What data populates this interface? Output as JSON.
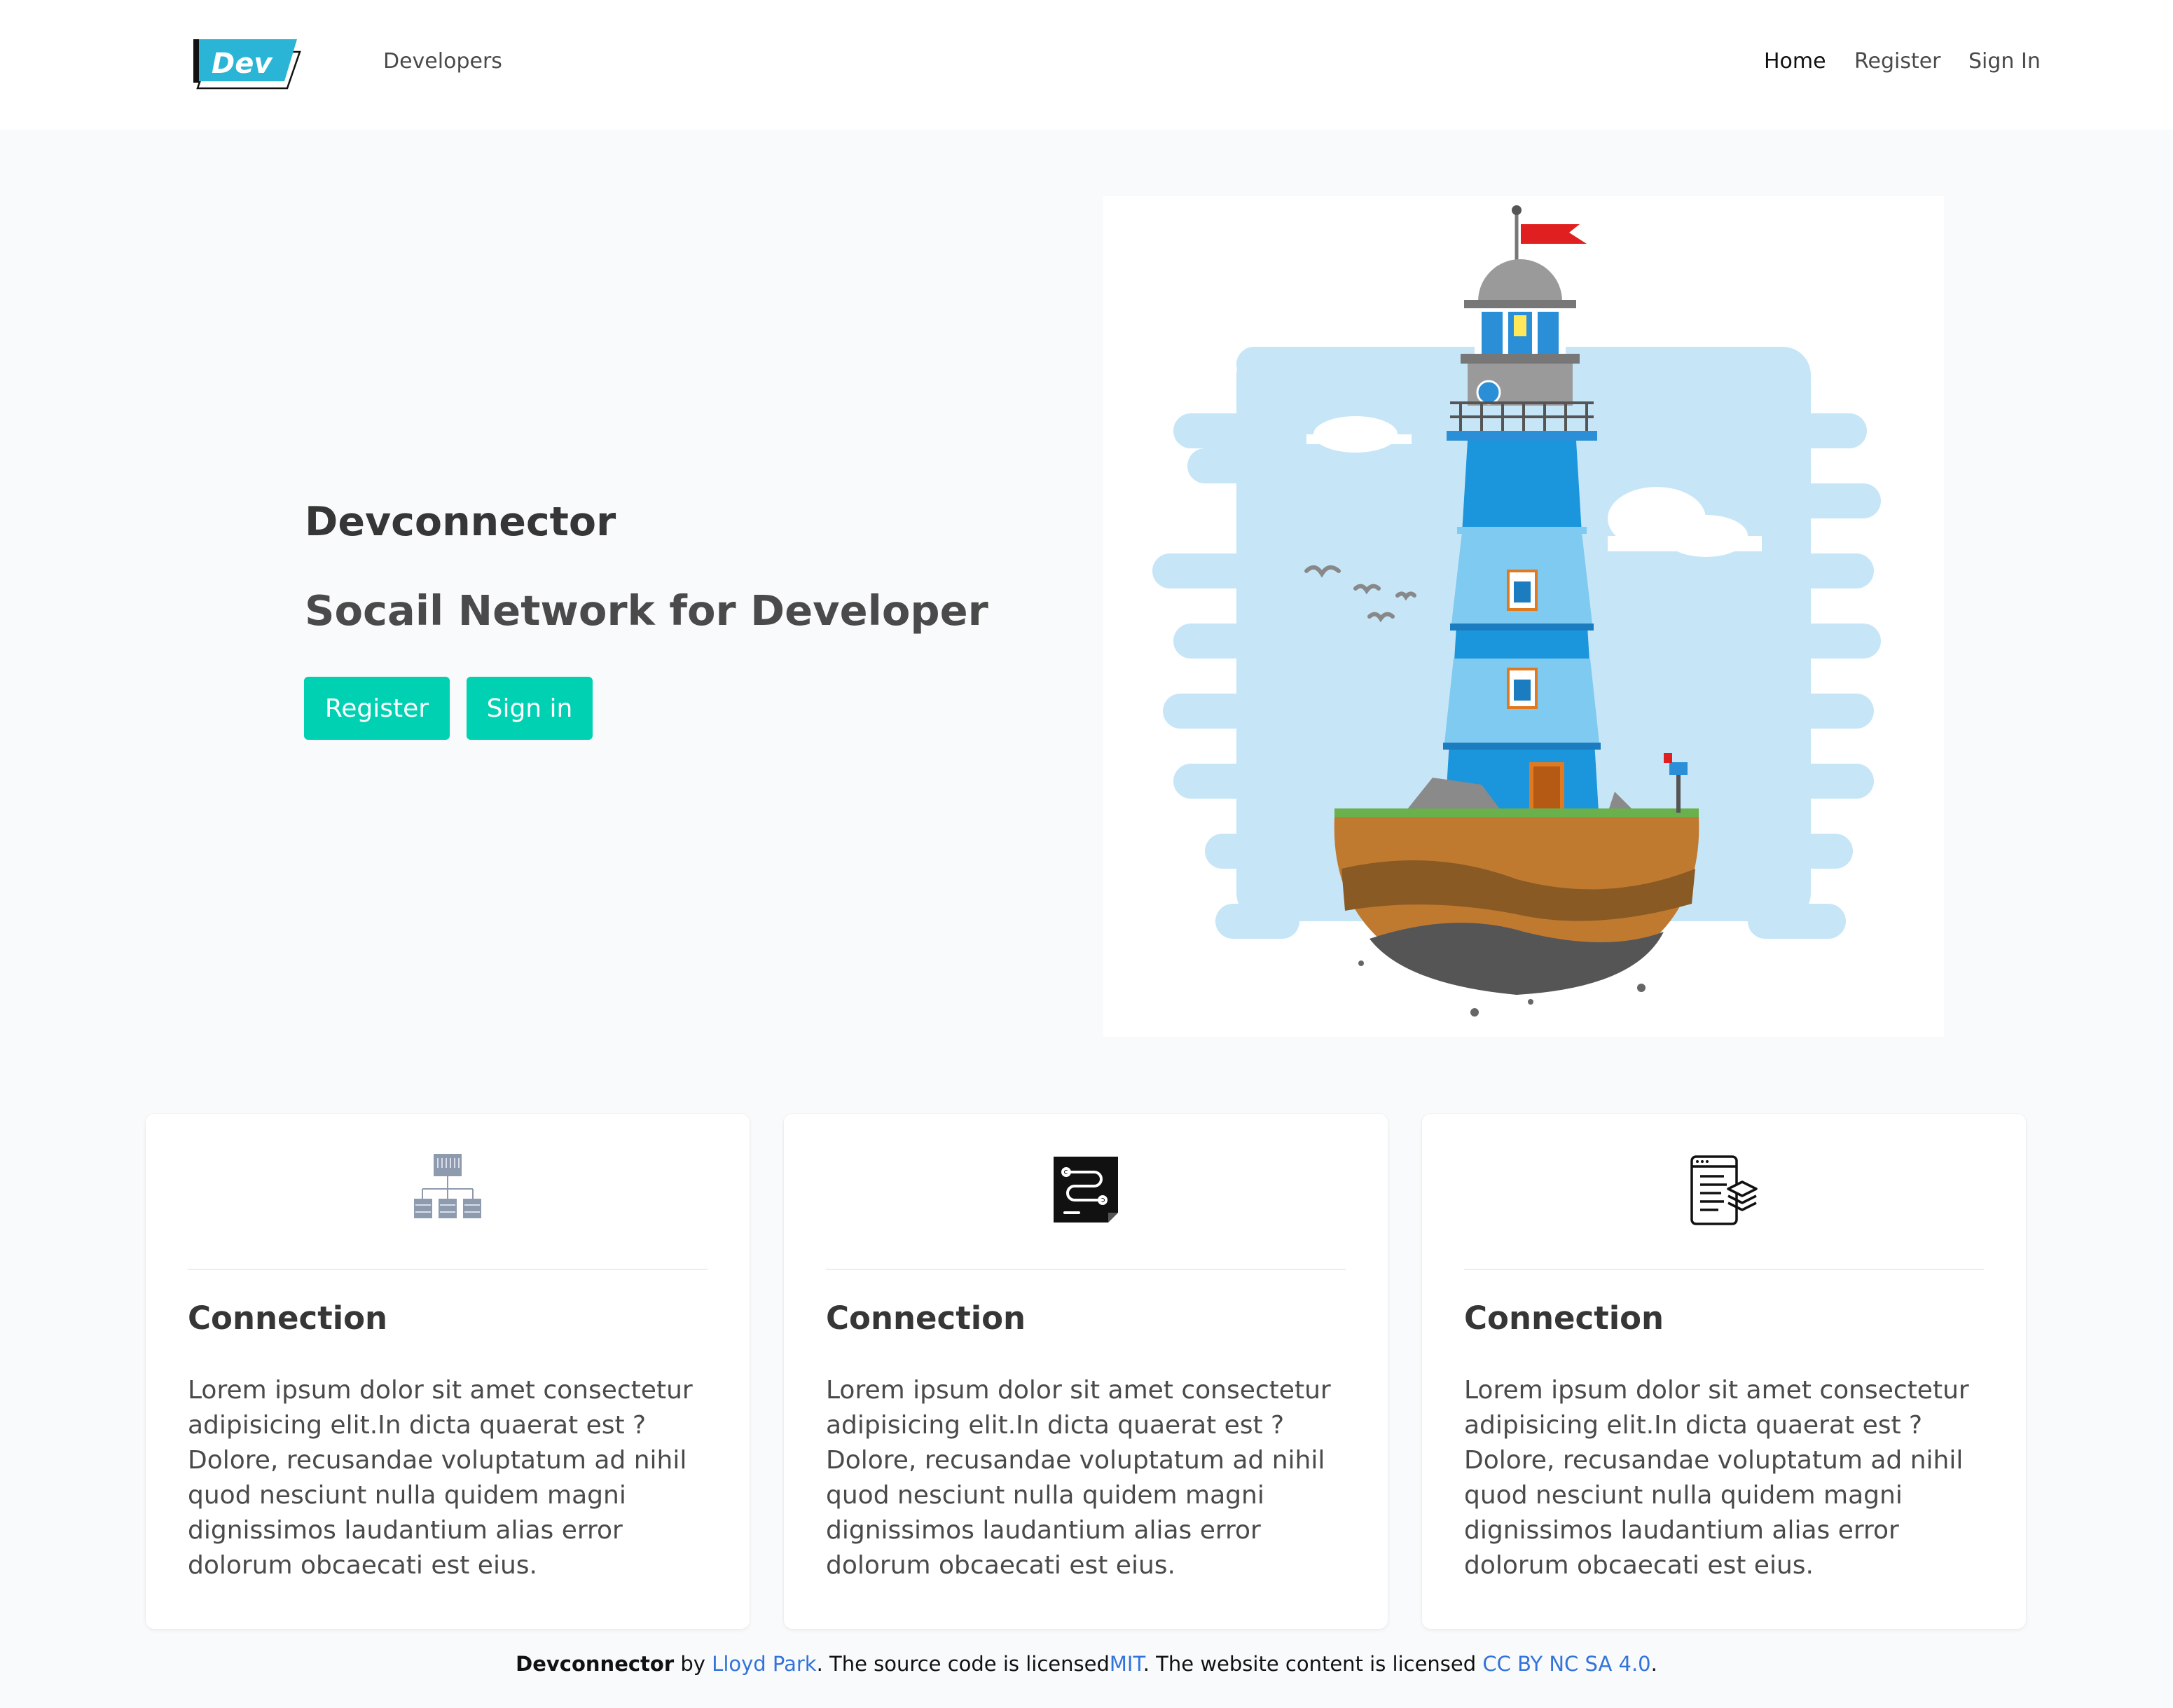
{
  "navbar": {
    "logo_text": "Dev",
    "developers_label": "Developers",
    "home_label": "Home",
    "register_label": "Register",
    "signin_label": "Sign In"
  },
  "hero": {
    "title": "Devconnector",
    "subtitle": "Socail Network for Developer",
    "register_button": "Register",
    "signin_button": "Sign in"
  },
  "cards": [
    {
      "icon": "network-hierarchy-icon",
      "title": "Connection",
      "text": "Lorem ipsum dolor sit amet consectetur adipisicing elit.In dicta quaerat est ? Dolore, recusandae voluptatum ad nihil quod nesciunt nulla quidem magni dignissimos laudantium alias error dolorum obcaecati est eius."
    },
    {
      "icon": "code-document-icon",
      "title": "Connection",
      "text": "Lorem ipsum dolor sit amet consectetur adipisicing elit.In dicta quaerat est ? Dolore, recusandae voluptatum ad nihil quod nesciunt nulla quidem magni dignissimos laudantium alias error dolorum obcaecati est eius."
    },
    {
      "icon": "layered-document-icon",
      "title": "Connection",
      "text": "Lorem ipsum dolor sit amet consectetur adipisicing elit.In dicta quaerat est ? Dolore, recusandae voluptatum ad nihil quod nesciunt nulla quidem magni dignissimos laudantium alias error dolorum obcaecati est eius."
    }
  ],
  "footer": {
    "brand": "Devconnector",
    "by": " by ",
    "author_link": "Lloyd Park",
    "mid1": ". The source code is licensed",
    "license_link": "MIT",
    "mid2": ". The website content is licensed ",
    "content_license_link": "CC BY NC SA 4.0",
    "end": "."
  },
  "colors": {
    "primary": "#00d1b2",
    "link": "#3273dc",
    "background": "#f9fafb"
  }
}
